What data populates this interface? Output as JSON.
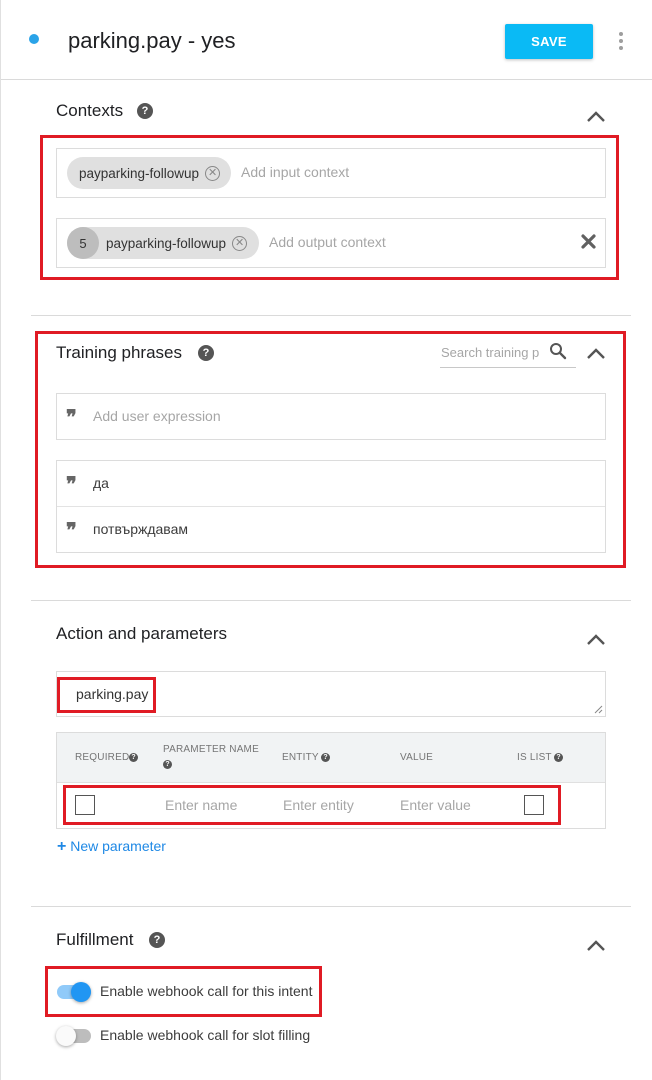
{
  "header": {
    "intent_name": "parking.pay - yes",
    "save_label": "SAVE"
  },
  "contexts": {
    "title": "Contexts",
    "input_chip": "payparking-followup",
    "input_placeholder": "Add input context",
    "output_lifespan": "5",
    "output_chip": "payparking-followup",
    "output_placeholder": "Add output context"
  },
  "training": {
    "title": "Training phrases",
    "search_placeholder": "Search training p",
    "add_placeholder": "Add user expression",
    "phrases": [
      "да",
      "потвърждавам"
    ]
  },
  "action": {
    "title": "Action and parameters",
    "action_value": "parking.pay",
    "columns": {
      "required": "REQUIRED",
      "parameter_name": "PARAMETER NAME",
      "entity": "ENTITY",
      "value": "VALUE",
      "is_list": "IS LIST"
    },
    "row": {
      "name_placeholder": "Enter name",
      "entity_placeholder": "Enter entity",
      "value_placeholder": "Enter value"
    },
    "new_parameter": "New parameter"
  },
  "fulfillment": {
    "title": "Fulfillment",
    "webhook_label": "Enable webhook call for this intent",
    "webhook_enabled": true,
    "slot_label": "Enable webhook call for slot filling",
    "slot_enabled": false
  },
  "colors": {
    "accent": "#0abaf5",
    "toggle_on": "#2196f3",
    "highlight": "#e01b24",
    "link": "#1e88e5"
  }
}
